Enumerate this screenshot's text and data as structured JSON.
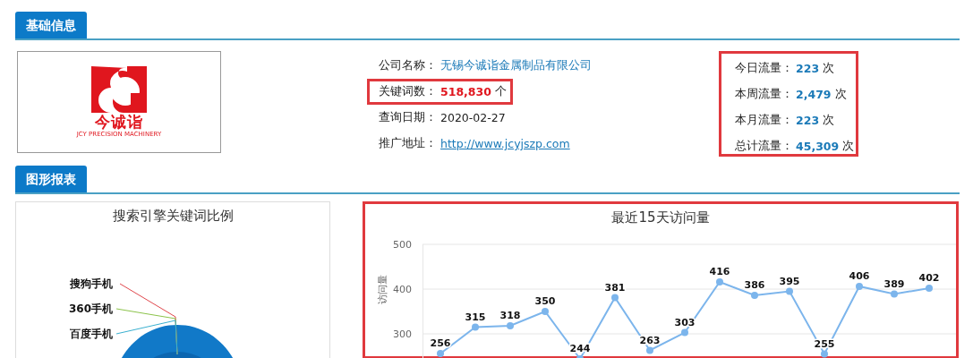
{
  "basic_section": {
    "title": "基础信息"
  },
  "logo": {
    "mark_text": "今诚诣",
    "tagline": "JCY PRECISION MACHINERY"
  },
  "info_fields": [
    {
      "label": "公司名称：",
      "value": "无锡今诚诣金属制品有限公司",
      "kind": "company",
      "highlighted": false
    },
    {
      "label": "关键词数：",
      "value": "518,830",
      "kind": "count",
      "unit": "个",
      "highlighted": true
    },
    {
      "label": "查询日期：",
      "value": "2020-02-27",
      "kind": "plain",
      "highlighted": false
    },
    {
      "label": "推广地址：",
      "value": "http://www.jcyjszp.com",
      "kind": "link",
      "highlighted": false
    }
  ],
  "traffic": {
    "highlighted": true,
    "items": [
      {
        "label": "今日流量：",
        "value": "223",
        "unit": "次"
      },
      {
        "label": "本周流量：",
        "value": "2,479",
        "unit": "次"
      },
      {
        "label": "本月流量：",
        "value": "223",
        "unit": "次"
      },
      {
        "label": "总计流量：",
        "value": "45,309",
        "unit": "次"
      }
    ]
  },
  "charts_section": {
    "title": "图形报表"
  },
  "engine_chart": {
    "title": "搜索引擎关键词比例",
    "labels": [
      {
        "text": "搜狗手机",
        "color": "#e0474c"
      },
      {
        "text": "360手机",
        "color": "#8bc34a"
      },
      {
        "text": "百度手机",
        "color": "#3ab0d0"
      }
    ]
  },
  "visits_chart": {
    "highlighted": true,
    "chart_data": {
      "type": "line",
      "title": "最近15天访问量",
      "ylabel": "访问量",
      "ylim": [
        240,
        500
      ],
      "yticks": [
        300,
        400,
        500
      ],
      "data_labels": true,
      "series": [
        {
          "color": "#7cb5ec",
          "marker": "circle",
          "values": [
            256,
            315,
            318,
            350,
            244,
            381,
            263,
            303,
            416,
            386,
            395,
            255,
            406,
            389,
            402
          ]
        }
      ]
    }
  }
}
